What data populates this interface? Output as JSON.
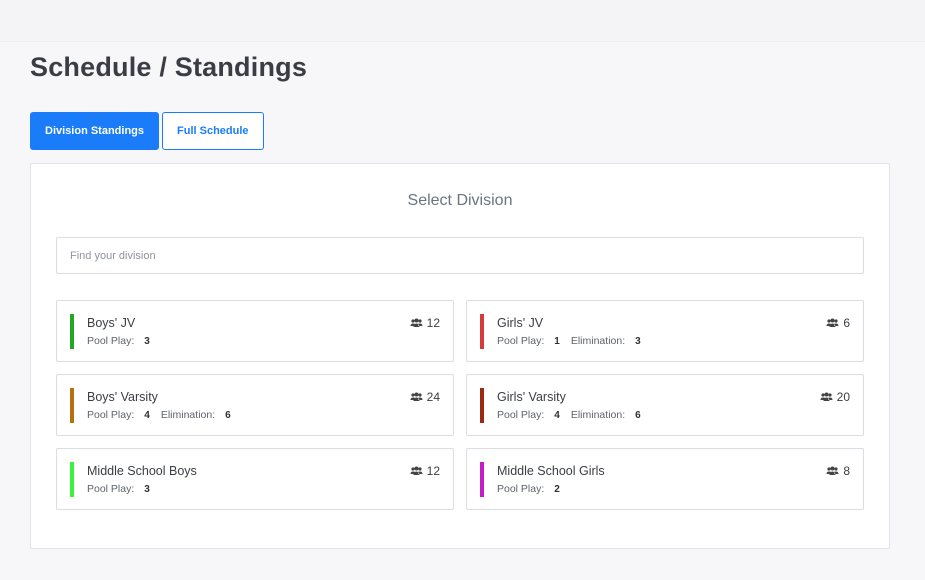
{
  "page": {
    "title": "Schedule / Standings"
  },
  "tabs": [
    {
      "label": "Division Standings",
      "active": true
    },
    {
      "label": "Full Schedule",
      "active": false
    }
  ],
  "panel": {
    "title": "Select Division",
    "search_placeholder": "Find your division"
  },
  "labels": {
    "pool_play": "Pool Play:",
    "elimination": "Elimination:"
  },
  "icons": {
    "team": "team-icon"
  },
  "divisions": [
    {
      "name": "Boys' JV",
      "color": "#22a822",
      "teams": "12",
      "pool_play": "3",
      "elimination": ""
    },
    {
      "name": "Girls' JV",
      "color": "#d63b3b",
      "teams": "6",
      "pool_play": "1",
      "elimination": "3"
    },
    {
      "name": "Boys' Varsity",
      "color": "#b5700f",
      "teams": "24",
      "pool_play": "4",
      "elimination": "6"
    },
    {
      "name": "Girls' Varsity",
      "color": "#9a2a10",
      "teams": "20",
      "pool_play": "4",
      "elimination": "6"
    },
    {
      "name": "Middle School Boys",
      "color": "#3ef03e",
      "teams": "12",
      "pool_play": "3",
      "elimination": ""
    },
    {
      "name": "Middle School Girls",
      "color": "#c41ec8",
      "teams": "8",
      "pool_play": "2",
      "elimination": ""
    }
  ]
}
